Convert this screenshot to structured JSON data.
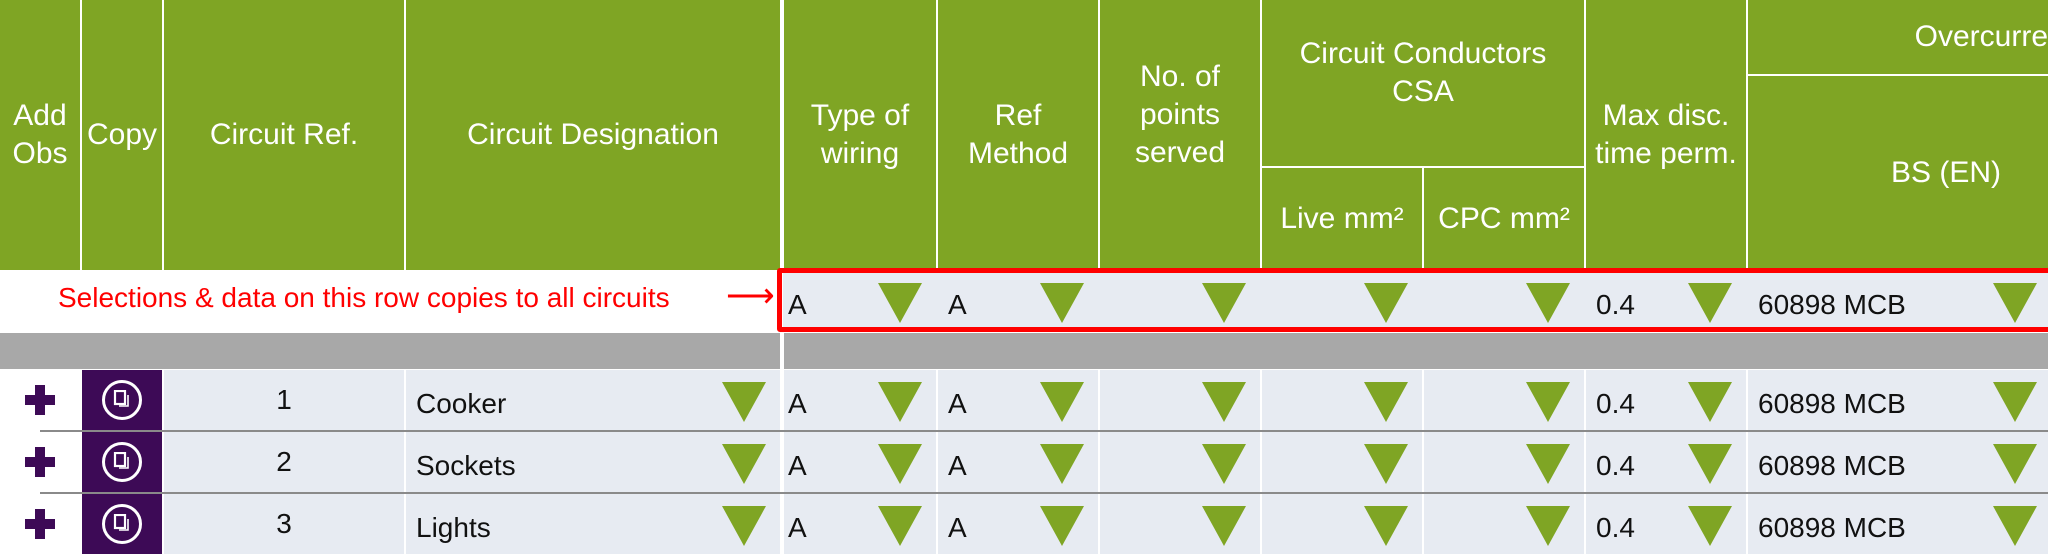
{
  "header": {
    "add_obs": "Add Obs",
    "copy": "Copy",
    "circuit_ref": "Circuit Ref.",
    "circuit_designation": "Circuit Designation",
    "type_of_wiring": "Type of wiring",
    "ref_method": "Ref Method",
    "no_of_points": "No. of points served",
    "conductors_group": "Circuit Conductors CSA",
    "live": "Live mm²",
    "cpc": "CPC mm²",
    "max_disc": "Max disc. time perm.",
    "overcurrent_group": "Overcurre",
    "bs_en": "BS (EN)"
  },
  "template_row": {
    "note": "Selections & data on this row copies to all circuits",
    "arrow": "⟶",
    "type_of_wiring": "A",
    "ref_method": "A",
    "no_of_points": "",
    "live": "",
    "cpc": "",
    "max_disc": "0.4",
    "bs_en": "60898 MCB"
  },
  "rows": [
    {
      "ref": "1",
      "designation": "Cooker",
      "type_of_wiring": "A",
      "ref_method": "A",
      "no_of_points": "",
      "live": "",
      "cpc": "",
      "max_disc": "0.4",
      "bs_en": "60898 MCB"
    },
    {
      "ref": "2",
      "designation": "Sockets",
      "type_of_wiring": "A",
      "ref_method": "A",
      "no_of_points": "",
      "live": "",
      "cpc": "",
      "max_disc": "0.4",
      "bs_en": "60898 MCB"
    },
    {
      "ref": "3",
      "designation": "Lights",
      "type_of_wiring": "A",
      "ref_method": "A",
      "no_of_points": "",
      "live": "",
      "cpc": "",
      "max_disc": "0.4",
      "bs_en": "60898 MCB"
    }
  ],
  "colors": {
    "header_green": "#7fa524",
    "accent_purple": "#3d0a56",
    "highlight_red": "#ff0000",
    "cell_bg": "#e7ebf2"
  }
}
